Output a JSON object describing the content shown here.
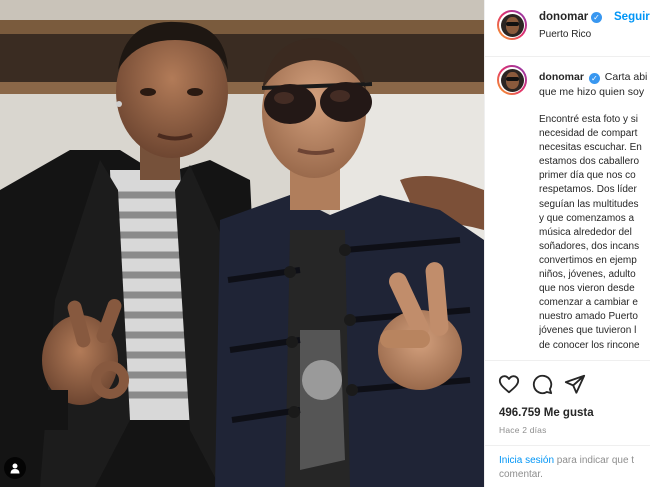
{
  "post": {
    "username": "donomar",
    "follow_label": "Seguir",
    "location": "Puerto Rico",
    "caption_intro_line1": "Carta abi",
    "caption_intro_line2": "que me hizo quien soy",
    "caption_lines": [
      "Encontré esta foto y si",
      "necesidad de compart",
      "necesitas escuchar. En",
      "estamos dos caballero",
      "primer día que nos co",
      "respetamos. Dos líder",
      "seguían las multitudes",
      "y que comenzamos a",
      "música alrededor del",
      "soñadores, dos incans",
      "convertimos en ejemp",
      "niños, jóvenes, adulto",
      "que nos vieron desde",
      "comenzar a cambiar e",
      "nuestro amado Puerto",
      "jóvenes que tuvieron l",
      "de conocer los rincone"
    ],
    "likes": "496.759 Me gusta",
    "time_ago": "Hace 2 días",
    "login_link": "Inicia sesión",
    "login_text_rest": " para indicar que t",
    "login_text_line2": "comentar.",
    "accent_color": "#0095f6",
    "verified_color": "#3897f0",
    "icons": [
      "verified-badge-icon",
      "heart-icon",
      "comment-icon",
      "share-icon",
      "user-tag-icon"
    ]
  }
}
